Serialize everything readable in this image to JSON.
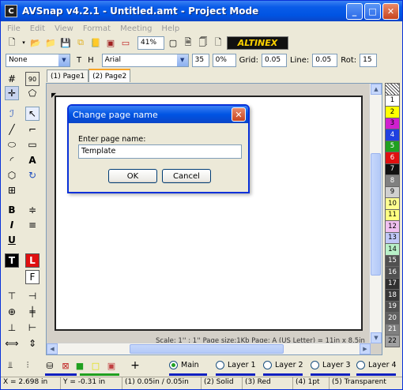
{
  "window": {
    "title": "AVSnap v4.2.1 - Untitled.amt  - Project Mode",
    "app_icon": "C"
  },
  "menu": [
    "File",
    "Edit",
    "View",
    "Format",
    "Meeting",
    "Help"
  ],
  "toolbar": {
    "zoom": "41%",
    "brand": "ALTINEX",
    "style_value": "None",
    "font_value": "Arial",
    "font_size": "35",
    "percent": "0%",
    "grid_label": "Grid:",
    "grid_value": "0.05",
    "line_label": "Line:",
    "line_value": "0.05",
    "rot_label": "Rot:",
    "rot_value": "15",
    "t_label": "T",
    "h_label": "H"
  },
  "tabs": [
    {
      "label": "(1) Page1",
      "active": false
    },
    {
      "label": "(2) Page2",
      "active": true
    }
  ],
  "canvas": {
    "scale_text": "Scale: 1'' : 1''   Page size:1Kb   Page: A (US Letter) = 11in x 8.5in"
  },
  "layers_palette": [
    {
      "label": "",
      "color": "#ffffff",
      "text": "#000"
    },
    {
      "label": "1",
      "color": "#ffffff",
      "text": "#000"
    },
    {
      "label": "2",
      "color": "#ffff00",
      "text": "#000"
    },
    {
      "label": "3",
      "color": "#d020d0",
      "text": "#000"
    },
    {
      "label": "4",
      "color": "#2040e0",
      "text": "#fff"
    },
    {
      "label": "5",
      "color": "#20a020",
      "text": "#fff"
    },
    {
      "label": "6",
      "color": "#e01010",
      "text": "#fff"
    },
    {
      "label": "7",
      "color": "#111111",
      "text": "#fff"
    },
    {
      "label": "8",
      "color": "#808080",
      "text": "#fff"
    },
    {
      "label": "9",
      "color": "#d0d0d0",
      "text": "#000"
    },
    {
      "label": "10",
      "color": "#ffff90",
      "text": "#000"
    },
    {
      "label": "11",
      "color": "#ffff80",
      "text": "#000"
    },
    {
      "label": "12",
      "color": "#f0c0f0",
      "text": "#000"
    },
    {
      "label": "13",
      "color": "#c0c8f8",
      "text": "#000"
    },
    {
      "label": "14",
      "color": "#b8f0c8",
      "text": "#000"
    },
    {
      "label": "15",
      "color": "#505050",
      "text": "#fff"
    },
    {
      "label": "16",
      "color": "#505050",
      "text": "#fff"
    },
    {
      "label": "17",
      "color": "#303030",
      "text": "#fff"
    },
    {
      "label": "18",
      "color": "#383838",
      "text": "#fff"
    },
    {
      "label": "19",
      "color": "#505050",
      "text": "#fff"
    },
    {
      "label": "20",
      "color": "#606060",
      "text": "#fff"
    },
    {
      "label": "21",
      "color": "#808080",
      "text": "#fff"
    },
    {
      "label": "22",
      "color": "#a0a0a0",
      "text": "#000"
    }
  ],
  "layer_select": {
    "main": "Main",
    "layers": [
      "Layer 1",
      "Layer 2",
      "Layer 3",
      "Layer 4"
    ],
    "line_colors": [
      "#1020c0",
      "#1020c0",
      "#1020c0",
      "#1020c0",
      "#1020c0"
    ]
  },
  "status": {
    "x": "X = 2.698 in",
    "y": "Y = -0.31 in",
    "line": "(1) 0.05in / 0.05in",
    "solid": "(2) Solid",
    "red": "(3) Red",
    "pt": "(4) 1pt",
    "transp": "(5) Transparent"
  },
  "dialog": {
    "title": "Change page name",
    "label": "Enter page name:",
    "value": "Template",
    "ok": "OK",
    "cancel": "Cancel"
  },
  "left_tools": {
    "t_black": "T",
    "l_red": "L",
    "bold": "B",
    "italic": "I",
    "underline": "U"
  }
}
